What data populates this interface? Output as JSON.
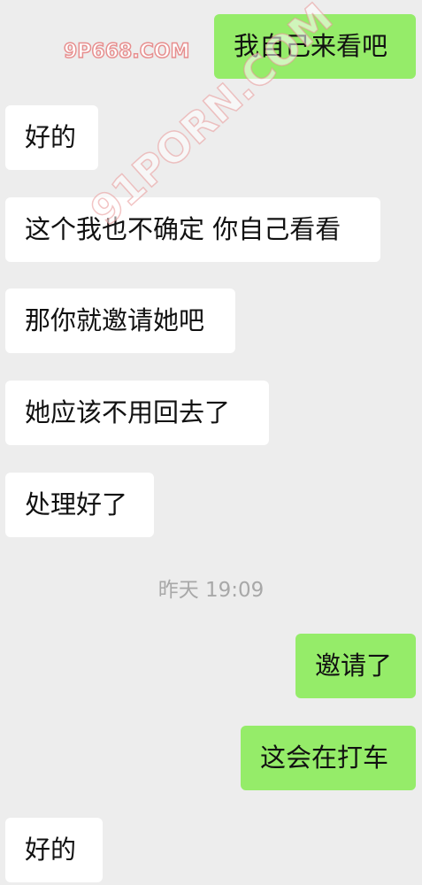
{
  "watermarks": {
    "small": "9P668.COM",
    "big": "91PORN.COM"
  },
  "messages": [
    {
      "direction": "outgoing",
      "text": "我自己来看吧"
    },
    {
      "direction": "incoming",
      "text": "好的"
    },
    {
      "direction": "incoming",
      "text": "这个我也不确定 你自己看看"
    },
    {
      "direction": "incoming",
      "text": "那你就邀请她吧"
    },
    {
      "direction": "incoming",
      "text": "她应该不用回去了"
    },
    {
      "direction": "incoming",
      "text": "处理好了"
    },
    {
      "direction": "outgoing",
      "text": "邀请了"
    },
    {
      "direction": "outgoing",
      "text": "这会在打车"
    },
    {
      "direction": "incoming",
      "text": "好的"
    }
  ],
  "timestamp": "昨天 19:09",
  "colors": {
    "background": "#ededed",
    "incoming_bubble": "#ffffff",
    "outgoing_bubble": "#95ec69",
    "timestamp_text": "#a8a8a8"
  }
}
